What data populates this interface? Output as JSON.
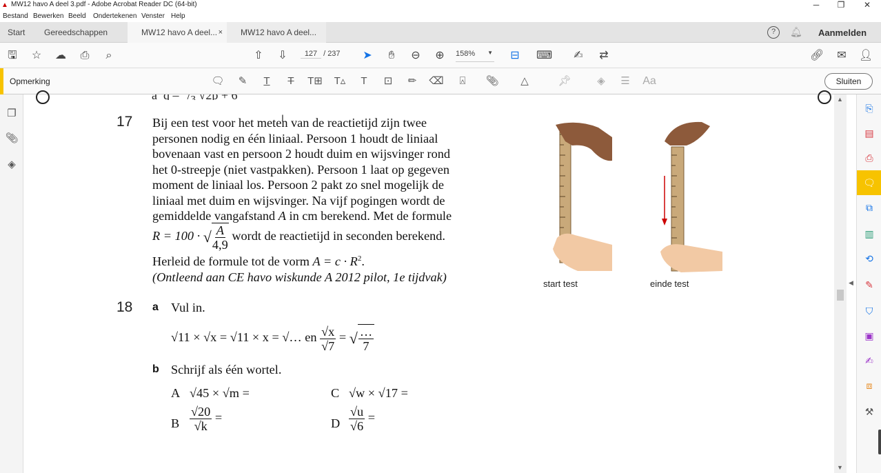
{
  "window": {
    "title": "MW12 havo A deel 3.pdf - Adobe Acrobat Reader DC (64-bit)",
    "minimize": "─",
    "maximize": "❐",
    "close": "✕"
  },
  "menu": [
    "Bestand",
    "Bewerken",
    "Beeld",
    "Ondertekenen",
    "Venster",
    "Help"
  ],
  "tabs": {
    "start": "Start",
    "tools": "Gereedschappen",
    "doc1": "MW12 havo A deel...",
    "doc1_close": "×",
    "doc2": "MW12 havo A deel...",
    "signin": "Aanmelden"
  },
  "toolbar": {
    "page_current": "127",
    "page_sep": "/",
    "page_total": "237",
    "zoom": "158%"
  },
  "commentbar": {
    "label": "Opmerking",
    "close": "Sluiten"
  },
  "document": {
    "q17_num": "17",
    "q17_lines": [
      "Bij een test voor het meten van de reactietijd zijn twee",
      "personen nodig en één liniaal. Persoon 1 houdt de liniaal",
      "bovenaan vast en persoon 2 houdt duim en wijsvinger rond",
      "het 0-streepje (niet vastpakken). Persoon 1 laat op gegeven",
      "moment de liniaal los. Persoon 2 pakt zo snel mogelijk de",
      "liniaal met duim en wijsvinger. Na vijf pogingen wordt de"
    ],
    "q17_line7a": "gemiddelde vangafstand",
    "q17_line7var": "A",
    "q17_line7b": "in cm berekend. Met de formule",
    "formula_lhs": "R = 100 ·",
    "formula_num": "A",
    "formula_den": "4,9",
    "formula_tail": "wordt de reactietijd in seconden berekend.",
    "herleid_a": "Herleid de formule tot de vorm",
    "herleid_b": "A = c · R",
    "herleid_exp": "2",
    "herleid_c": ".",
    "source": "(Ontleend aan CE havo wiskunde A 2012 pilot, 1e tijdvak)",
    "caption_start": "start test",
    "caption_end": "einde test",
    "q18_num": "18",
    "q18a_label": "a",
    "q18a_text": "Vul in.",
    "q18a_expr": "√11 × √x = √11 × x = √… en",
    "q18a_f1_num": "√x",
    "q18a_f1_den": "√7",
    "q18a_eq": "=",
    "q18a_f2_num": "…",
    "q18a_f2_den": "7",
    "q18b_label": "b",
    "q18b_text": "Schrijf als één wortel.",
    "A_label": "A",
    "A_expr": "√45 × √m =",
    "C_label": "C",
    "C_expr": "√w × √17 =",
    "B_label": "B",
    "B_num": "√20",
    "B_den": "√k",
    "B_eq": "=",
    "D_label": "D",
    "D_num": "√u",
    "D_den": "√6",
    "D_eq": "="
  },
  "colors": {
    "accent": "#f7c300",
    "pdf_red": "#c8102e",
    "right_panel_icons": [
      "#1473e6",
      "#d7373f",
      "#d7373f",
      "#1473e6",
      "#2d9d78",
      "#1473e6",
      "#d7373f",
      "#1473e6",
      "#9c35c9",
      "#9c35c9",
      "#e68619",
      "#555555"
    ]
  }
}
